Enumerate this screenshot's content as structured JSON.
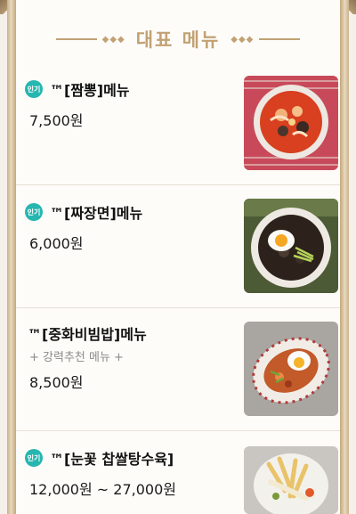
{
  "header": {
    "title": "대표 메뉴"
  },
  "badge_label": "인기",
  "menu": [
    {
      "name": "™[짬뽕]메뉴",
      "price": "7,500원",
      "popular": true,
      "image_icon": "jjamppong-photo"
    },
    {
      "name": "™[짜장면]메뉴",
      "price": "6,000원",
      "popular": true,
      "image_icon": "jjajangmyeon-photo"
    },
    {
      "name": "™[중화비빔밥]메뉴",
      "subtitle": "+ 강력추천 메뉴 +",
      "price": "8,500원",
      "popular": false,
      "image_icon": "bibimbap-photo"
    },
    {
      "name": "™[눈꽃 찹쌀탕수육]",
      "price": "12,000원 ~ 27,000원",
      "popular": true,
      "image_icon": "tangsuyuk-photo"
    }
  ],
  "colors": {
    "accent": "#c2a173",
    "badge": "#27b6b0",
    "rail": "#d8c3a0"
  }
}
